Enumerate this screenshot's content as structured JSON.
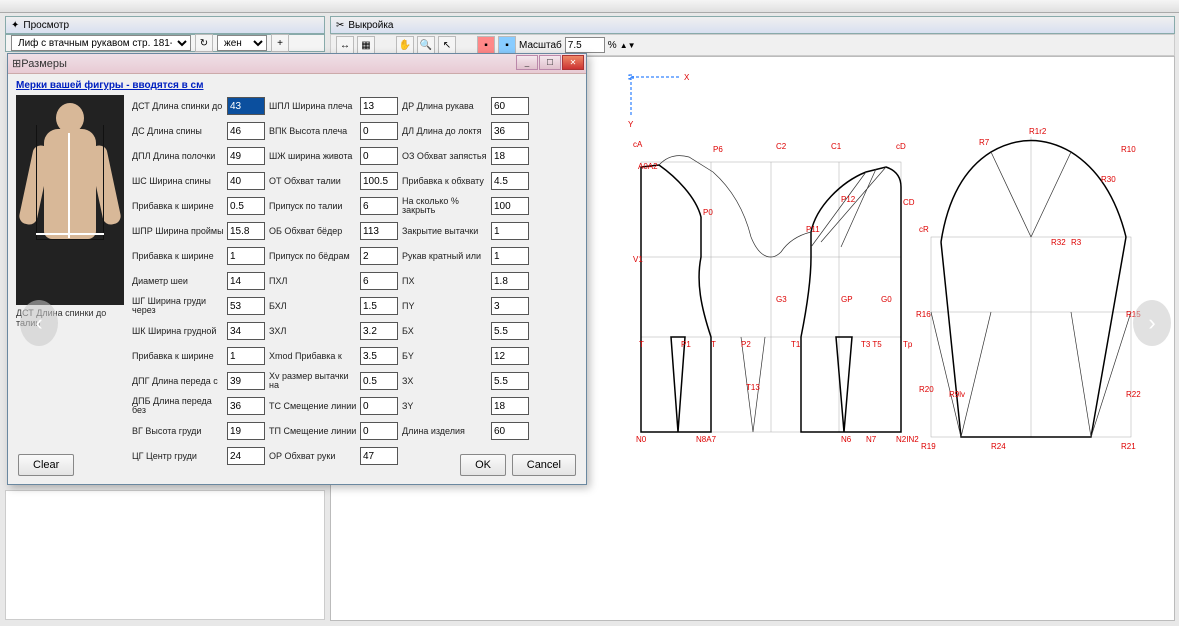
{
  "preview": {
    "title": "Просмотр",
    "dropdown": "Лиф с втачным рукавом стр. 181-225",
    "gender": "жен"
  },
  "pattern": {
    "title": "Выкройка",
    "scale_label": "Масштаб",
    "scale_value": "7.5",
    "scale_pct": "%"
  },
  "dialog": {
    "title": "Размеры",
    "intro": "Мерки вашей фигуры - вводятся в см",
    "photo_caption": "ДСТ Длина спинки до талии",
    "buttons": {
      "clear": "Clear",
      "ok": "OK",
      "cancel": "Cancel"
    }
  },
  "cols": {
    "c1": [
      {
        "l": "ДСТ Длина спинки до",
        "v": "43",
        "hl": true
      },
      {
        "l": "ДС Длина спины",
        "v": "46"
      },
      {
        "l": "ДПЛ Длина полочки",
        "v": "49"
      },
      {
        "l": "ШС Ширина спины",
        "v": "40"
      },
      {
        "l": "Прибавка к ширине",
        "v": "0.5"
      },
      {
        "l": "ШПР Ширина проймы",
        "v": "15.8"
      },
      {
        "l": "Прибавка к ширине",
        "v": "1"
      },
      {
        "l": "Диаметр шеи",
        "v": "14"
      },
      {
        "l": "ШГ Ширина груди через",
        "v": "53"
      },
      {
        "l": "ШК Ширина грудной",
        "v": "34"
      },
      {
        "l": "Прибавка к ширине",
        "v": "1"
      },
      {
        "l": "ДПГ Длина переда с",
        "v": "39"
      },
      {
        "l": "ДПБ Длина переда без",
        "v": "36"
      },
      {
        "l": "ВГ Высота груди",
        "v": "19"
      },
      {
        "l": "ЦГ Центр груди",
        "v": "24"
      }
    ],
    "c2": [
      {
        "l": "ШПЛ Ширина плеча",
        "v": "13"
      },
      {
        "l": "ВПК Высота плеча",
        "v": "0"
      },
      {
        "l": "ШЖ ширина живота",
        "v": "0"
      },
      {
        "l": "ОТ Обхват талии",
        "v": "100.5"
      },
      {
        "l": "Припуск по талии",
        "v": "6"
      },
      {
        "l": "ОБ Обхват бёдер",
        "v": "113"
      },
      {
        "l": "Припуск по бёдрам",
        "v": "2"
      },
      {
        "l": "ПХЛ",
        "v": "6"
      },
      {
        "l": "БХЛ",
        "v": "1.5"
      },
      {
        "l": "ЗХЛ",
        "v": "3.2"
      },
      {
        "l": "Xmod Прибавка к",
        "v": "3.5"
      },
      {
        "l": "Xv размер вытачки на",
        "v": "0.5"
      },
      {
        "l": "ТС Смещение линии",
        "v": "0"
      },
      {
        "l": "ТП Смещение линии",
        "v": "0"
      },
      {
        "l": "ОР Обхват руки",
        "v": "47"
      }
    ],
    "c3": [
      {
        "l": "ДР Длина рукава",
        "v": "60"
      },
      {
        "l": "ДЛ Длина до локтя",
        "v": "36"
      },
      {
        "l": "ОЗ Обхват запястья",
        "v": "18"
      },
      {
        "l": "Прибавка к обхвату",
        "v": "4.5"
      },
      {
        "l": "На сколько % закрыть",
        "v": "100"
      },
      {
        "l": "Закрытие вытачки",
        "v": "1"
      },
      {
        "l": "Рукав кратный или",
        "v": "1"
      },
      {
        "l": "ПХ",
        "v": "1.8"
      },
      {
        "l": "ПY",
        "v": "3"
      },
      {
        "l": "БХ",
        "v": "5.5"
      },
      {
        "l": "БY",
        "v": "12"
      },
      {
        "l": "ЗХ",
        "v": "5.5"
      },
      {
        "l": "ЗY",
        "v": "18"
      },
      {
        "l": "Длина изделия",
        "v": "60"
      }
    ]
  },
  "labels_body": [
    "A0",
    "A2",
    "cA",
    "P6",
    "C2",
    "C1",
    "cD",
    "V1",
    "P0",
    "P11",
    "P12",
    "CD",
    "G3",
    "GP",
    "G0",
    "P1",
    "P2",
    "T",
    "T1",
    "T3",
    "T5",
    "Tp",
    "N0",
    "N6",
    "N7",
    "N2",
    "R7",
    "R1",
    "R2",
    "R10",
    "R30",
    "cR",
    "R16",
    "R15",
    "R20",
    "R22",
    "R19",
    "R24",
    "R21"
  ]
}
